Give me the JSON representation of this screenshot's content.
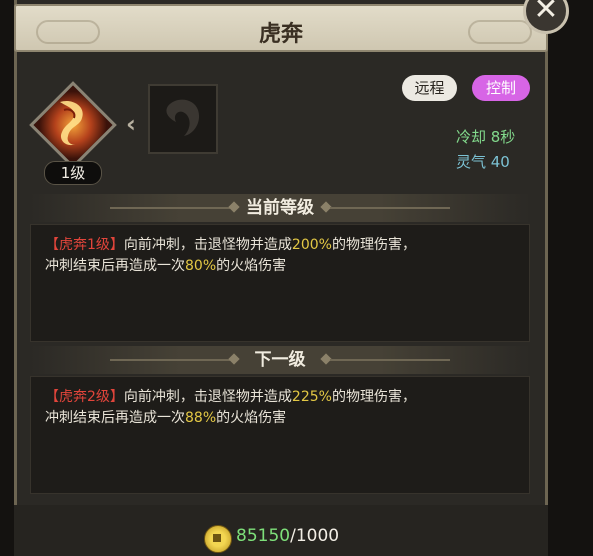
{
  "title": "虎奔",
  "close_label": "✕",
  "skill": {
    "level_badge": "1级"
  },
  "tags": {
    "range": "远程",
    "control": "控制"
  },
  "stats": {
    "cooldown": "冷却 8秒",
    "qi": "灵气 40"
  },
  "current": {
    "header": "当前等级",
    "tag": "【虎奔1级】",
    "text1": "向前冲刺，击退怪物并造成",
    "pct1": "200%",
    "text2": "的物理伤害，",
    "text3": "冲刺结束后再造成一次",
    "pct2": "80%",
    "text4": "的火焰伤害"
  },
  "next": {
    "header": "下一级",
    "tag": "【虎奔2级】",
    "text1": "向前冲刺，击退怪物并造成",
    "pct1": "225%",
    "text2": "的物理伤害，",
    "text3": "冲刺结束后再造成一次",
    "pct2": "88%",
    "text4": "的火焰伤害"
  },
  "cost": {
    "have": "85150",
    "need": "/1000"
  },
  "icons": {
    "skill": "tiger-dash-icon",
    "next_skill": "locked-skill-icon",
    "currency": "gold-coin-icon"
  },
  "colors": {
    "highlight_red": "#e2453b",
    "highlight_yellow": "#e3c845",
    "tag_control": "#d765e6",
    "cost_have": "#7ee07a"
  }
}
